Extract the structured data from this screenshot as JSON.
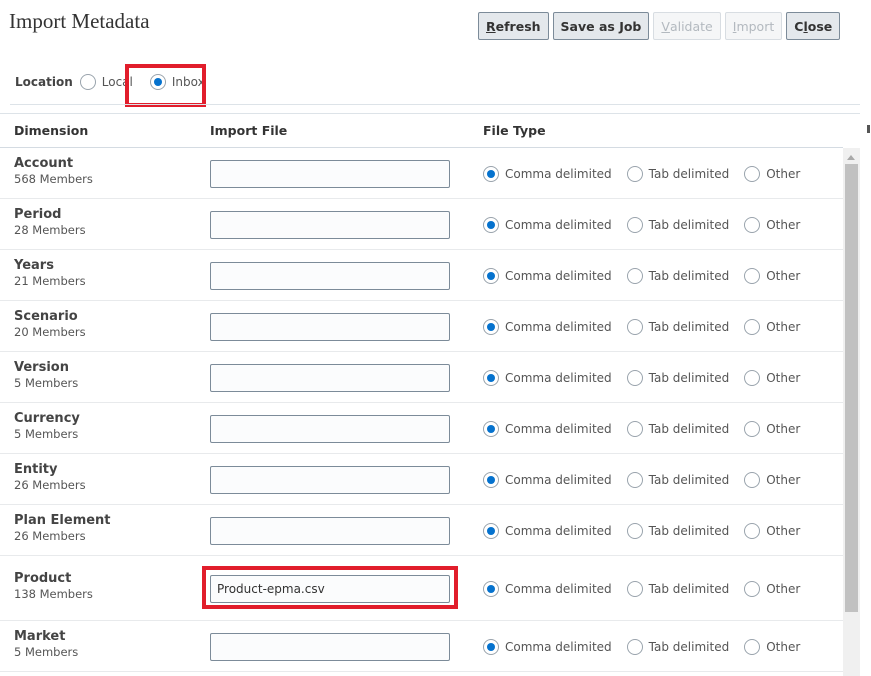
{
  "title": "Import Metadata",
  "toolbar": {
    "buttons": [
      {
        "key": "refresh",
        "pre": "",
        "u": "R",
        "post": "efresh",
        "enabled": true
      },
      {
        "key": "save-as-job",
        "pre": "Save as Job",
        "u": "",
        "post": "",
        "enabled": true
      },
      {
        "key": "validate",
        "pre": "",
        "u": "V",
        "post": "alidate",
        "enabled": false
      },
      {
        "key": "import",
        "pre": "",
        "u": "I",
        "post": "mport",
        "enabled": false
      },
      {
        "key": "close",
        "pre": "C",
        "u": "l",
        "post": "ose",
        "enabled": true
      }
    ]
  },
  "location": {
    "label": "Location",
    "options": [
      "Local",
      "Inbox"
    ],
    "selected": "Inbox"
  },
  "grid": {
    "headers": {
      "dimension": "Dimension",
      "import_file": "Import File",
      "file_type": "File Type"
    },
    "file_type_options": [
      "Comma delimited",
      "Tab delimited",
      "Other"
    ],
    "rows": [
      {
        "name": "Account",
        "members": "568 Members",
        "file": "",
        "file_type": "Comma delimited"
      },
      {
        "name": "Period",
        "members": "28 Members",
        "file": "",
        "file_type": "Comma delimited"
      },
      {
        "name": "Years",
        "members": "21 Members",
        "file": "",
        "file_type": "Comma delimited"
      },
      {
        "name": "Scenario",
        "members": "20 Members",
        "file": "",
        "file_type": "Comma delimited"
      },
      {
        "name": "Version",
        "members": "5 Members",
        "file": "",
        "file_type": "Comma delimited"
      },
      {
        "name": "Currency",
        "members": "5 Members",
        "file": "",
        "file_type": "Comma delimited"
      },
      {
        "name": "Entity",
        "members": "26 Members",
        "file": "",
        "file_type": "Comma delimited"
      },
      {
        "name": "Plan Element",
        "members": "26 Members",
        "file": "",
        "file_type": "Comma delimited"
      },
      {
        "name": "Product",
        "members": "138 Members",
        "file": "Product-epma.csv",
        "file_type": "Comma delimited"
      },
      {
        "name": "Market",
        "members": "5 Members",
        "file": "",
        "file_type": "Comma delimited"
      }
    ]
  },
  "colors": {
    "accent": "#0572ce",
    "highlight": "#e11d2b"
  }
}
